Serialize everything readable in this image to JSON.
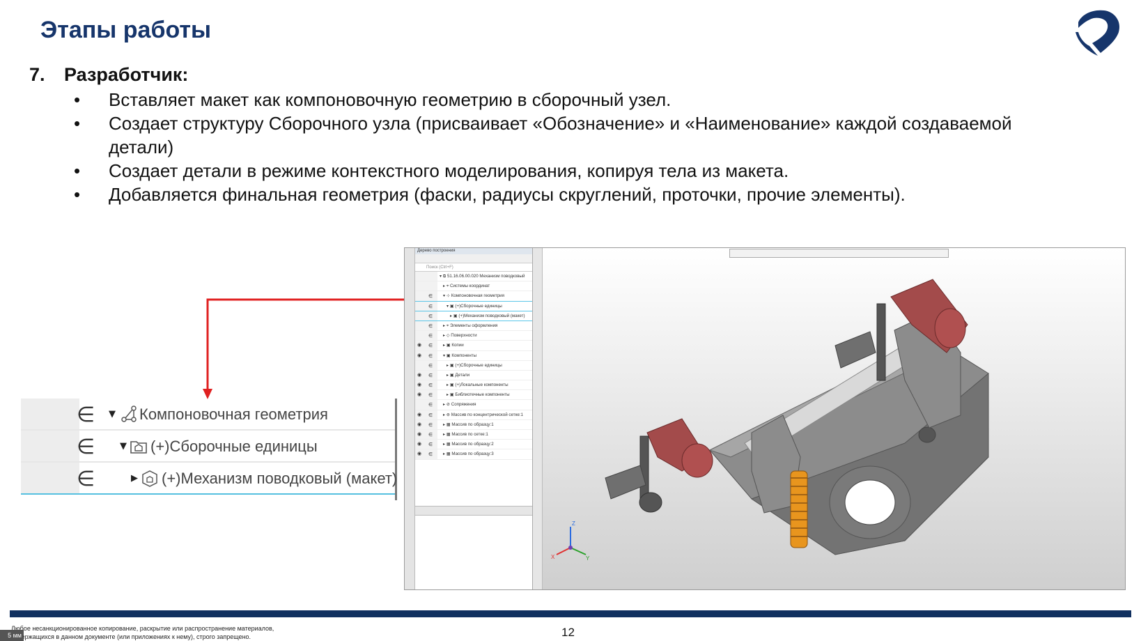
{
  "header": {
    "title": "Этапы работы"
  },
  "step": {
    "number": "7.",
    "title": "Разработчик:",
    "bullets": [
      "Вставляет макет как компоновочную геометрию в сборочный узел.",
      "Создает структуру Сборочного узла (присваивает «Обозначение» и «Наименование» каждой создаваемой детали)",
      "Создает детали в режиме контекстного моделирования, копируя тела из макета.",
      "Добавляется финальная геометрия (фаски, радиусы скруглений, проточки, прочие элементы)."
    ],
    "bullet_glyph": "•"
  },
  "callout": {
    "rows": [
      {
        "symbol": "∈",
        "label": "Компоновочная геометрия"
      },
      {
        "symbol": "∈",
        "label": "(+)Сборочные единицы"
      },
      {
        "symbol": "∈",
        "label": "(+)Механизм поводковый (макет)"
      }
    ]
  },
  "cad": {
    "panel_title": "Дерево построения",
    "search_placeholder": "Поиск (Ctrl+F)",
    "tree": [
      {
        "eye": "",
        "e": "",
        "indent": 1,
        "text": "▾ ⧉ 51.16.06.00.020 Механизм поводковый"
      },
      {
        "eye": "",
        "e": "",
        "indent": 2,
        "text": "▸ ⌖ Системы координат"
      },
      {
        "eye": "",
        "e": "∈",
        "indent": 2,
        "text": "▾ ⊹ Компоновочная геометрия"
      },
      {
        "eye": "",
        "e": "∈",
        "indent": 3,
        "text": "▾ ▣ (+)Сборочные единицы"
      },
      {
        "eye": "",
        "e": "∈",
        "indent": 4,
        "text": "▸ ▣ (+)Механизм поводковый (макет)"
      },
      {
        "eye": "",
        "e": "∈",
        "indent": 2,
        "text": "▸ ⌖ Элементы оформления"
      },
      {
        "eye": "",
        "e": "∈",
        "indent": 2,
        "text": "▸ ◇ Поверхности"
      },
      {
        "eye": "◉",
        "e": "∈",
        "indent": 2,
        "text": "▸ ▣ Копии"
      },
      {
        "eye": "◉",
        "e": "∈",
        "indent": 2,
        "text": "▾ ▣ Компоненты"
      },
      {
        "eye": "",
        "e": "∈",
        "indent": 3,
        "text": "▸ ▣ (+)Сборочные единицы"
      },
      {
        "eye": "◉",
        "e": "∈",
        "indent": 3,
        "text": "▸ ▣ Детали"
      },
      {
        "eye": "◉",
        "e": "∈",
        "indent": 3,
        "text": "▸ ▣ (+)Локальные компоненты"
      },
      {
        "eye": "◉",
        "e": "∈",
        "indent": 3,
        "text": "▸ ▣ Библиотечные компоненты"
      },
      {
        "eye": "",
        "e": "∈",
        "indent": 2,
        "text": "▸ ⊘ Сопряжения"
      },
      {
        "eye": "◉",
        "e": "∈",
        "indent": 2,
        "text": "▸ ⊚ Массив по концентрической сетке:1"
      },
      {
        "eye": "◉",
        "e": "∈",
        "indent": 2,
        "text": "▸ ▦ Массив по образцу:1"
      },
      {
        "eye": "◉",
        "e": "∈",
        "indent": 2,
        "text": "▸ ▦ Массив по сетке:1"
      },
      {
        "eye": "◉",
        "e": "∈",
        "indent": 2,
        "text": "▸ ▦ Массив по образцу:2"
      },
      {
        "eye": "◉",
        "e": "∈",
        "indent": 2,
        "text": "▸ ▦ Массив по образцу:3"
      }
    ],
    "axis_labels": {
      "x": "X",
      "y": "Y",
      "z": "Z"
    }
  },
  "colors": {
    "title": "#16356b",
    "footer_bar": "#10305f",
    "arrow": "#e02020",
    "selection": "#55c0e0",
    "lever_red": "#a34b4b",
    "spring_orange": "#e8951e",
    "body_gray": "#8c8c8c"
  },
  "footer": {
    "disclaimer_line1": "Любое несанкционированное копирование, раскрытие или распространение материалов,",
    "disclaimer_line2": "содержащихся в данном документе (или приложениях к нему), строго запрещено.",
    "mm_tab": "5 мм",
    "page_number": "12"
  }
}
